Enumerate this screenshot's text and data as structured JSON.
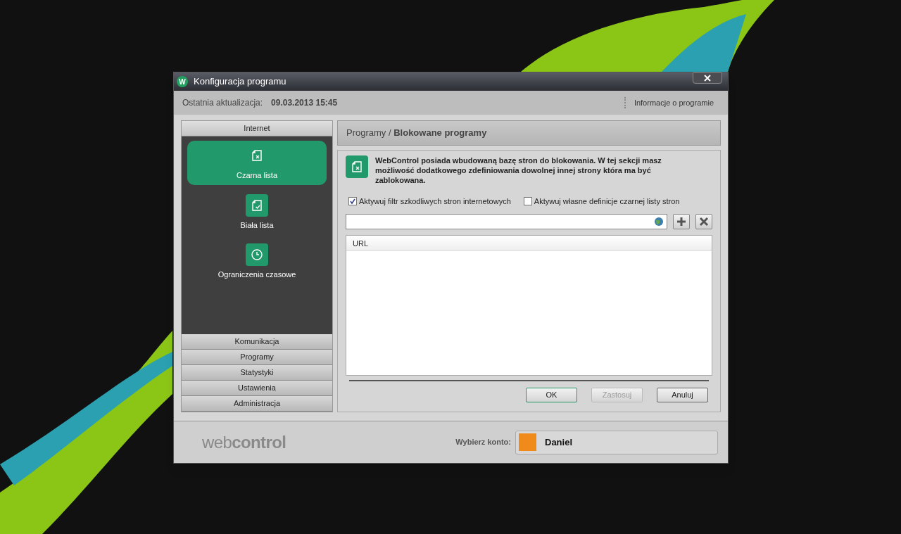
{
  "window": {
    "title": "Konfiguracja programu",
    "logo_letter": "W"
  },
  "header": {
    "update_label": "Ostatnia aktualizacja:",
    "update_value": "09.03.2013 15:45",
    "about_link": "Informacje o programie"
  },
  "sidebar": {
    "sections": [
      {
        "label": "Internet",
        "expanded": true,
        "items": [
          {
            "label": "Czarna lista",
            "kind": "doc-x",
            "selected": true
          },
          {
            "label": "Biała lista",
            "kind": "doc-check",
            "selected": false
          },
          {
            "label": "Ograniczenia czasowe",
            "kind": "clock",
            "selected": false
          }
        ]
      },
      {
        "label": "Komunikacja",
        "expanded": false
      },
      {
        "label": "Programy",
        "expanded": false
      },
      {
        "label": "Statystyki",
        "expanded": false
      },
      {
        "label": "Ustawienia",
        "expanded": false
      },
      {
        "label": "Administracja",
        "expanded": false
      }
    ]
  },
  "content": {
    "breadcrumb": "Programy / **Blokowane programy**",
    "description": "WebControl posiada wbudowaną bazę stron do blokowania. W tej sekcji masz możliwość dodatkowego zdefiniowania dowolnej innej strony która ma być zablokowana.",
    "checkboxes": [
      {
        "label": "Aktywuj filtr szkodliwych stron internetowych",
        "checked": true
      },
      {
        "label": "Aktywuj własne definicje czarnej listy stron",
        "checked": false
      }
    ],
    "table": {
      "columns": [
        "URL"
      ]
    },
    "buttons": [
      {
        "label": "OK",
        "disabled": false,
        "default": true
      },
      {
        "label": "Zastosuj",
        "disabled": true,
        "default": false
      },
      {
        "label": "Anuluj",
        "disabled": false,
        "default": false
      }
    ]
  },
  "footer": {
    "logo_light": "web",
    "logo_bold": "control",
    "account_label": "Wybierz konto:",
    "account_name": "Daniel"
  }
}
